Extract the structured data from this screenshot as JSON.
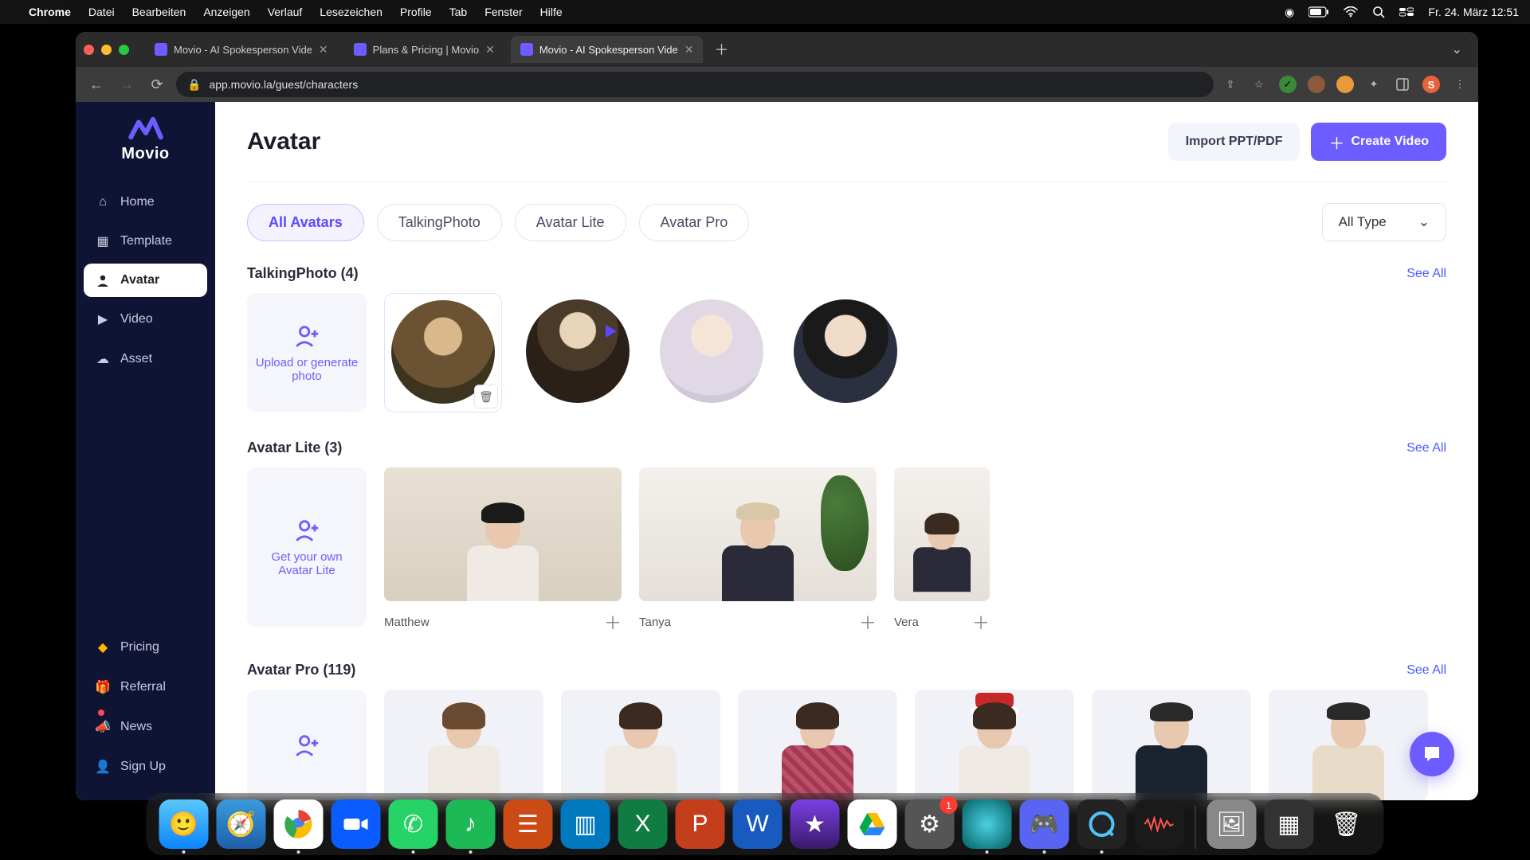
{
  "mac_menu": {
    "app": "Chrome",
    "items": [
      "Datei",
      "Bearbeiten",
      "Anzeigen",
      "Verlauf",
      "Lesezeichen",
      "Profile",
      "Tab",
      "Fenster",
      "Hilfe"
    ],
    "clock": "Fr. 24. März  12:51"
  },
  "browser": {
    "tabs": [
      {
        "title": "Movio - AI Spokesperson Vide",
        "active": false
      },
      {
        "title": "Plans & Pricing | Movio",
        "active": false
      },
      {
        "title": "Movio - AI Spokesperson Vide",
        "active": true
      }
    ],
    "url": "app.movio.la/guest/characters"
  },
  "sidebar": {
    "brand": "Movio",
    "items": [
      {
        "key": "home",
        "label": "Home"
      },
      {
        "key": "template",
        "label": "Template"
      },
      {
        "key": "avatar",
        "label": "Avatar",
        "active": true
      },
      {
        "key": "video",
        "label": "Video"
      },
      {
        "key": "asset",
        "label": "Asset"
      }
    ],
    "bottom": [
      {
        "key": "pricing",
        "label": "Pricing"
      },
      {
        "key": "referral",
        "label": "Referral"
      },
      {
        "key": "news",
        "label": "News",
        "dot": true
      },
      {
        "key": "signup",
        "label": "Sign Up"
      }
    ]
  },
  "page": {
    "title": "Avatar",
    "import_btn": "Import PPT/PDF",
    "create_btn": "Create Video"
  },
  "filters": {
    "pills": [
      "All Avatars",
      "TalkingPhoto",
      "Avatar Lite",
      "Avatar Pro"
    ],
    "active": "All Avatars",
    "type_dd": "All Type"
  },
  "talkingphoto": {
    "title": "TalkingPhoto (4)",
    "seeall": "See All",
    "upload_label": "Upload or generate photo"
  },
  "avatarlite": {
    "title": "Avatar Lite (3)",
    "seeall": "See All",
    "get_label": "Get your own Avatar Lite",
    "items": [
      {
        "name": "Matthew"
      },
      {
        "name": "Tanya"
      },
      {
        "name": "Vera"
      }
    ]
  },
  "avatarpro": {
    "title": "Avatar Pro (119)",
    "seeall": "See All"
  },
  "dock": {
    "badge_settings": "1"
  }
}
